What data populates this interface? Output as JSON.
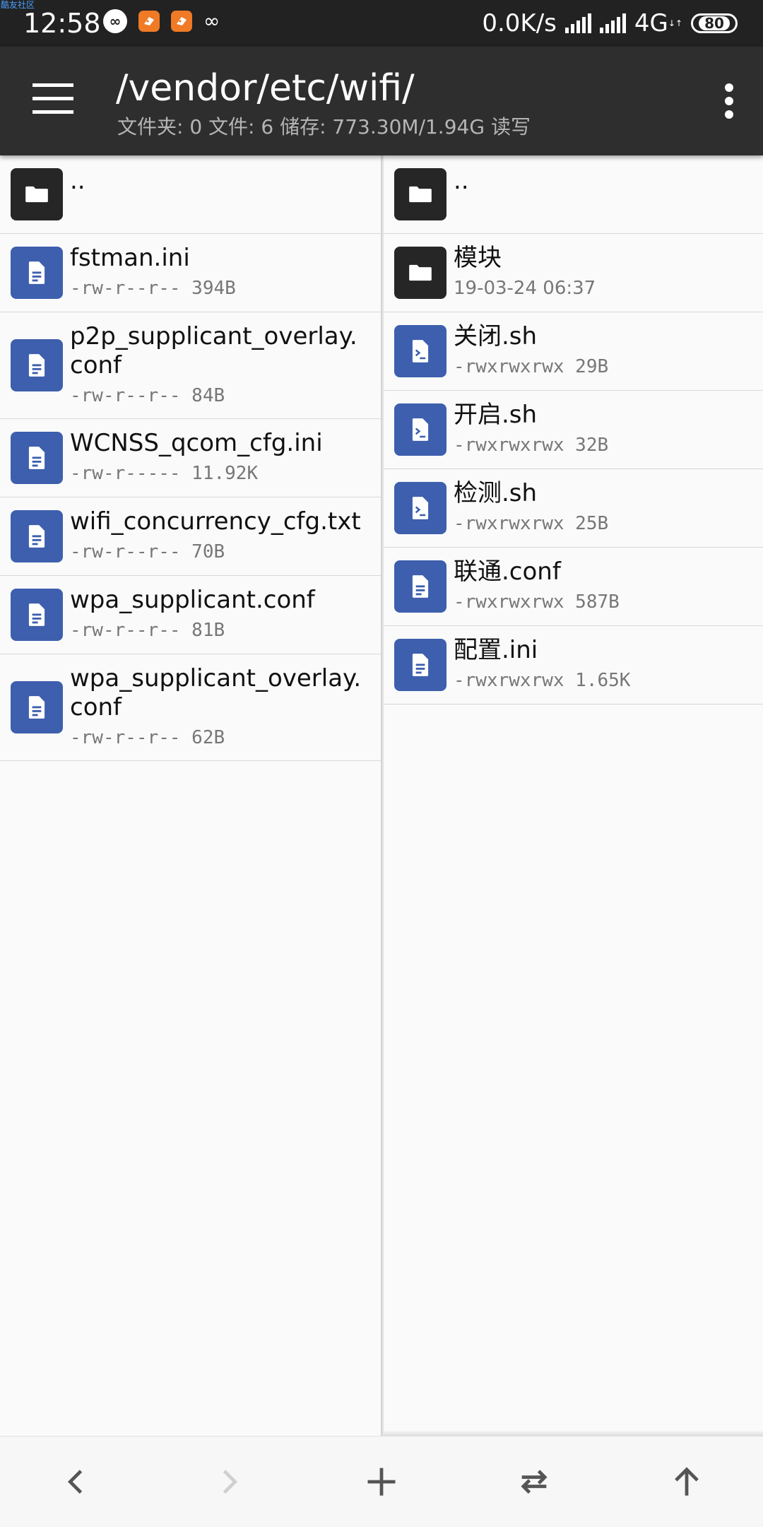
{
  "status_bar": {
    "watermark": "酷友社区",
    "time": "12:58",
    "network_speed": "0.0K/s",
    "network_type": "4G",
    "battery": "80",
    "icons": [
      "loop-icon",
      "app-icon",
      "app-icon",
      "loop-icon",
      "signal-icon",
      "signal-icon",
      "battery-icon"
    ]
  },
  "toolbar": {
    "title": "/vendor/etc/wifi/",
    "subtitle": "文件夹: 0  文件: 6  储存: 773.30M/1.94G  读写"
  },
  "left_pane": {
    "items": [
      {
        "type": "folder",
        "name": "..",
        "meta": ""
      },
      {
        "type": "file",
        "name": "fstman.ini",
        "meta": "-rw-r--r-- 394B"
      },
      {
        "type": "file",
        "name": "p2p_supplicant_overlay.conf",
        "meta": "-rw-r--r-- 84B"
      },
      {
        "type": "file",
        "name": "WCNSS_qcom_cfg.ini",
        "meta": "-rw-r----- 11.92K"
      },
      {
        "type": "file",
        "name": "wifi_concurrency_cfg.txt",
        "meta": "-rw-r--r-- 70B"
      },
      {
        "type": "file",
        "name": "wpa_supplicant.conf",
        "meta": "-rw-r--r-- 81B"
      },
      {
        "type": "file",
        "name": "wpa_supplicant_overlay.conf",
        "meta": "-rw-r--r-- 62B"
      }
    ]
  },
  "right_pane": {
    "items": [
      {
        "type": "folder",
        "name": "..",
        "meta": ""
      },
      {
        "type": "folder",
        "name": "模块",
        "meta": "19-03-24 06:37"
      },
      {
        "type": "script",
        "name": "关闭.sh",
        "meta": "-rwxrwxrwx 29B"
      },
      {
        "type": "script",
        "name": "开启.sh",
        "meta": "-rwxrwxrwx 32B"
      },
      {
        "type": "script",
        "name": "检测.sh",
        "meta": "-rwxrwxrwx 25B"
      },
      {
        "type": "file",
        "name": "联通.conf",
        "meta": "-rwxrwxrwx 587B"
      },
      {
        "type": "file",
        "name": "配置.ini",
        "meta": "-rwxrwxrwx 1.65K"
      }
    ]
  },
  "bottom_nav": [
    "back-icon",
    "forward-icon",
    "add-icon",
    "swap-icon",
    "up-icon"
  ],
  "colors": {
    "toolbar": "#2e2e2e",
    "status_bar": "#222222",
    "file_icon": "#3d5fad",
    "folder_icon": "#262626"
  }
}
